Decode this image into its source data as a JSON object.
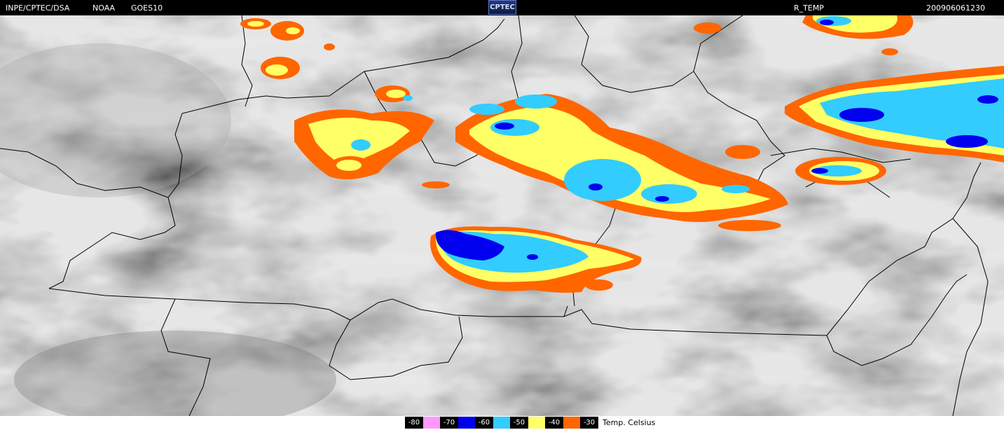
{
  "header": {
    "agency": "INPE/CPTEC/DSA",
    "source": "NOAA",
    "satellite": "GOES10",
    "logo_text": "CPTEC",
    "product": "R_TEMP",
    "timestamp": "200906061230"
  },
  "legend": {
    "title": "Temp. Celsius",
    "items": [
      {
        "label": "-80",
        "color": "#ff99ff"
      },
      {
        "label": "-70",
        "color": "#0000ee"
      },
      {
        "label": "-60",
        "color": "#33ccff"
      },
      {
        "label": "-50",
        "color": "#ffff66"
      },
      {
        "label": "-40",
        "color": "#ff6600"
      },
      {
        "label": "-30",
        "color": ""
      }
    ]
  },
  "colors": {
    "background_cloud_gray": "#6e6e6e",
    "border_lines": "#000000",
    "orange": "#ff6600",
    "yellow": "#ffff66",
    "cyan": "#33ccff",
    "blue": "#0000ee",
    "pink": "#ff99ff"
  }
}
